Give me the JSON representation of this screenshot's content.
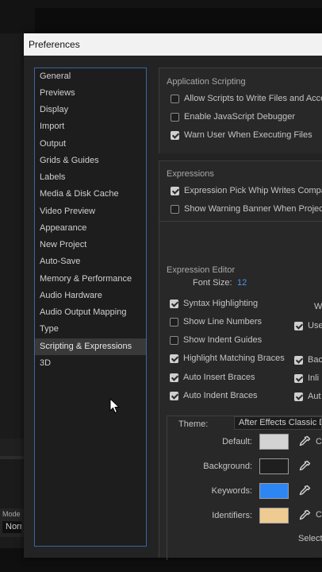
{
  "background": {
    "mode_label": "Mode",
    "mode_value": "Norm"
  },
  "dialog": {
    "title": "Preferences",
    "categories": [
      "General",
      "Previews",
      "Display",
      "Import",
      "Output",
      "Grids & Guides",
      "Labels",
      "Media & Disk Cache",
      "Video Preview",
      "Appearance",
      "New Project",
      "Auto-Save",
      "Memory & Performance",
      "Audio Hardware",
      "Audio Output Mapping",
      "Type",
      "Scripting & Expressions",
      "3D"
    ],
    "selected_category": "Scripting & Expressions"
  },
  "application_scripting": {
    "title": "Application Scripting",
    "options": [
      {
        "label": "Allow Scripts to Write Files and Acce",
        "checked": false
      },
      {
        "label": "Enable JavaScript Debugger",
        "checked": false
      },
      {
        "label": "Warn User When Executing Files",
        "checked": true
      }
    ]
  },
  "expressions": {
    "title": "Expressions",
    "options": [
      {
        "label": "Expression Pick Whip Writes Compac",
        "checked": true
      },
      {
        "label": "Show Warning Banner When Project",
        "checked": false
      }
    ]
  },
  "expression_editor": {
    "title": "Expression Editor",
    "font_size_label": "Font Size:",
    "font_size_value": "12",
    "left_options": [
      {
        "label": "Syntax Highlighting",
        "checked": true
      },
      {
        "label": "Show Line Numbers",
        "checked": false
      },
      {
        "label": "Show Indent Guides",
        "checked": false
      },
      {
        "label": "Highlight Matching Braces",
        "checked": true
      },
      {
        "label": "Auto Insert Braces",
        "checked": true
      },
      {
        "label": "Auto Indent Braces",
        "checked": true
      }
    ],
    "right_options": [
      {
        "label": "Use",
        "checked": true
      },
      {
        "label": "Bac",
        "checked": true
      },
      {
        "label": "Inli",
        "checked": true
      },
      {
        "label": "Aut",
        "checked": true
      }
    ],
    "right_cut_text": {
      "w": "W",
      "c1": "C",
      "c2": "C",
      "select": "Select"
    },
    "theme_label": "Theme:",
    "theme_value": "After Effects Classic Dark",
    "colors": [
      {
        "label": "Default:",
        "color": "#d3d3d3"
      },
      {
        "label": "Background:",
        "color": "#1f1f1f"
      },
      {
        "label": "Keywords:",
        "color": "#2e86f2"
      },
      {
        "label": "Identifiers:",
        "color": "#eecb91"
      }
    ]
  }
}
